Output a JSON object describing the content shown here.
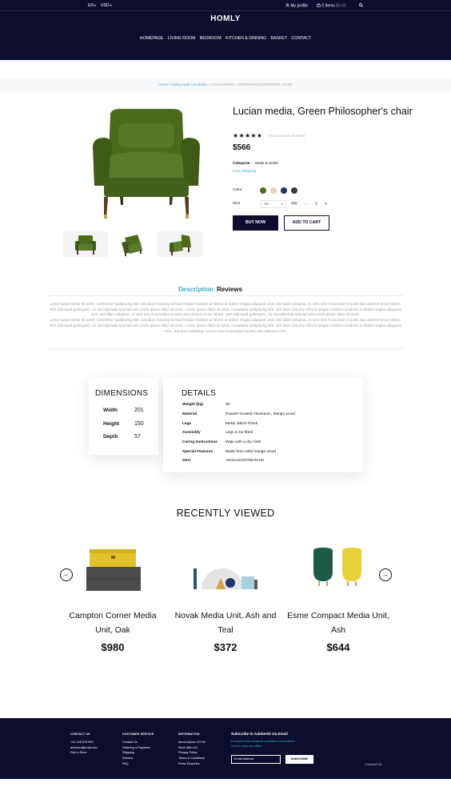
{
  "header": {
    "language": "EN",
    "currency": "USD",
    "profile": "My profile",
    "cart_items": "0 Items",
    "cart_total": "$0.00",
    "logo": "HOMLY",
    "nav": [
      "HOMEPAGE",
      "LIVING ROOM",
      "BEDROOM",
      "KITCHEN & DINNING",
      "BASKET",
      "CONTACT"
    ]
  },
  "breadcrumb": {
    "items": [
      "Home",
      "Living room",
      "products"
    ],
    "current": "LUCIAN MEDIA, GREEN PHILOSOPHER'S CHAIR",
    "separator": "/"
  },
  "product": {
    "title": "Lucian media, Green Philosopher's chair",
    "stars": "★★★★★",
    "rating_value": 5,
    "reviews": "(75 Customer reviews)",
    "price": "$566",
    "category_label": "Categorie:",
    "category_value": "Seats & Sofas",
    "free_shipping": "Free shipping",
    "color_label": "Color",
    "colors": [
      "#4f6d1f",
      "#e6d3b9",
      "#23336b",
      "#3b3b3b"
    ],
    "size_label": "Size",
    "size_value": "XS",
    "qty_label": "Qty",
    "qty_minus": "-",
    "qty_value": "1",
    "qty_plus": "+",
    "buy_label": "BUY NOW",
    "cart_label": "ADD TO CART"
  },
  "tabs": {
    "description": "Description",
    "reviews": "Reviews",
    "text1": "Lorem ipsum dolor sit amet, consetetur sadipscing elitr, sed diam nonumy eirmod tempor invidunt ut labore et dolore magna aliquyam erat, sed diam voluptua. At vero eos et accusam et justo duo dolores et ea rebum. Stet clita kasd gubergren, no sea takimata sanctus est Lorem ipsum dolor sit amet. Lorem ipsum dolor sit amet, consetetur sadipscing elitr, sed diam nonumy eirmod tempor invidunt ut labore et dolore magna aliquyam erat, sed diam voluptua. At vero eos et accusam et justo duo dolores et ea rebum. Stet clita kasd gubergren, no sea takimata sanctus est Lorem ipsum dolor sit amet.",
    "text2": "Lorem ipsum dolor sit amet, consetetur sadipscing elitr, sed diam nonumy eirmod tempor invidunt ut labore et dolore magna aliquyam erat, sed diam voluptua. At vero eos et accusam et justo duo dolores et ea rebum. Stet clita kasd gubergren, no sea takimata sanctus est Lorem ipsum dolor sit amet. Lorem ipsum dolor sit amet, consetetur sadipscing elitr, sed diam nonumy eirmod tempor invidunt ut labore et dolore magna aliquyam erat, sed diam voluptua. At vero eos et accusam et justo duo dolores et ea"
  },
  "dimensions": {
    "title": "DIMENSIONS",
    "rows": [
      {
        "label": "Width",
        "value": "201"
      },
      {
        "label": "Height",
        "value": "150"
      },
      {
        "label": "Depth",
        "value": "57"
      }
    ]
  },
  "details": {
    "title": "DETAILS",
    "rows": [
      {
        "label": "Weight (kg)",
        "value": "30"
      },
      {
        "label": "Material",
        "value": "Powder-Coated Aluminium, Mango wood"
      },
      {
        "label": "Legs",
        "value": "Metal, Black Finish"
      },
      {
        "label": "Assembly",
        "value": "Legs to be fitted"
      },
      {
        "label": "Caring Instructions",
        "value": "Wipe with a dry cloth"
      },
      {
        "label": "Special Features",
        "value": "Made from solid mango wood"
      },
      {
        "label": "SKU",
        "value": "AVULUCOOTMAN-UK"
      }
    ]
  },
  "recently_viewed": {
    "title": "RECENTLY VIEWED",
    "items": [
      {
        "name": "Campton Corner Media Unit, Oak",
        "price": "$980"
      },
      {
        "name": "Novak Media Unit, Ash and Teal",
        "price": "$372"
      },
      {
        "name": "Esme Compact Media Unit, Ash",
        "price": "$644"
      }
    ],
    "prev_icon": "←",
    "next_icon": "→"
  },
  "footer": {
    "contact_heading": "CONTACT US",
    "contact_lines": [
      "+44 345 678 903",
      "adobexd@mail.com",
      "Find a Store"
    ],
    "service_heading": "CUSTOMER SERVICE",
    "service_lines": [
      "Contact Us",
      "Ordering & Payment",
      "Shipping",
      "Returns",
      "FAQ"
    ],
    "info_heading": "INFORMATION",
    "info_lines": [
      "About Adobe XD Kit",
      "Work With US",
      "Privacy Policy",
      "Terms & Conditions",
      "Press Enquiries"
    ],
    "subscribe_heading": "Subscribe to AdobeXD via Email",
    "subscribe_text": "Excepteur sint occaecat cupidatat non proident, sunt in culpa qui officia",
    "email_placeholder": "Email Address",
    "subscribe_button": "SUBSCRIBE",
    "credit": "© AdobeXD Kit"
  }
}
